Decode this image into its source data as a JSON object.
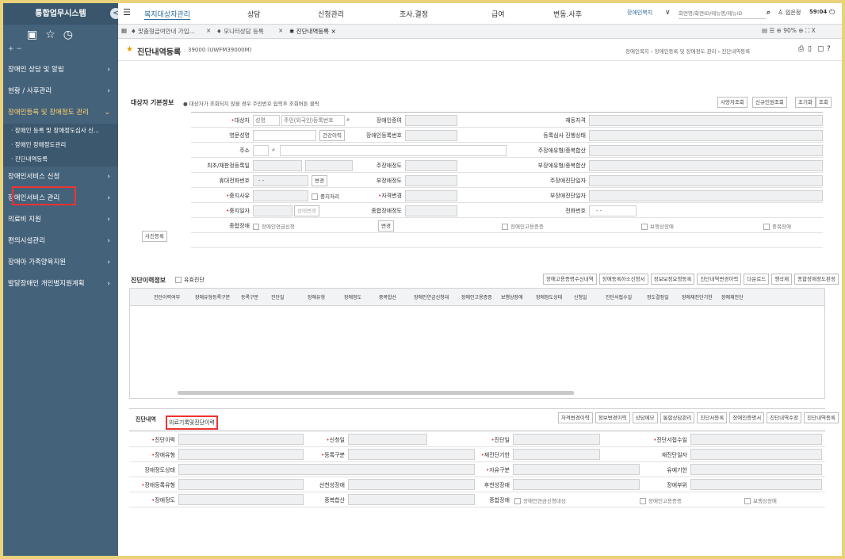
{
  "app": {
    "title": "통합업무시스템",
    "collapse": "<"
  },
  "sidebar": {
    "pm": "+ −",
    "icons": [
      "doc-icon",
      "star-icon",
      "clock-icon"
    ],
    "menu1": "장애인 상담 및 알림",
    "menu2": "현황 / 사후관리",
    "menu3": "장애인등록 및 장애정도 관리",
    "sub1": "· 장애인 등록 및 장애정도심사 신...",
    "sub2": "· 장애인 장애정도관리",
    "sub3": "· 진단내역등록",
    "menu4": "장애인서비스 신청",
    "menu5": "장애인서비스 관리",
    "menu6": "의료비 지원",
    "menu7": "편의시설관리",
    "menu8": "장애아 가족양육지원",
    "menu9": "발달장애인 개인별지원계획"
  },
  "topbar": {
    "hamburger": "☰",
    "tab1": "복지대상자관리",
    "tab2": "상담",
    "tab3": "신청관리",
    "tab4": "조사.결정",
    "tab5": "급여",
    "tab6": "변동.사후",
    "org": "장애인복지",
    "search_placeholder": "화면명/화면ID/메뉴명/메뉴ID",
    "user": "임은정",
    "timer": "59:04"
  },
  "tabs": {
    "t1": "♦ 맞춤형급여안내 가입...",
    "t2": "♦ 모니터상담 등록",
    "t3": "✱ 진단내역등록 ×",
    "right": "▤ ☰ ⊕ 90% ⊕ ⛶ X"
  },
  "page": {
    "star": "★",
    "title": "진단내역등록",
    "code": "39000 (UWFM39000M)",
    "breadcrumb": "장애인복지 › 장애인등록 및 장애정도 관리 › 진단내역등록"
  },
  "section1": {
    "title": "대상자 기본정보",
    "note": "대상자가 조회되지 않을 경우 주민번호 입력후 조회버튼 클릭",
    "btn1": "사망자조회",
    "btn2": "신규인원조회",
    "btn3": "초기화",
    "btn4": "조회"
  },
  "form": {
    "l_target": "대상자",
    "ph_name": "성명",
    "ph_rrn": "주민(외국인)등록번호",
    "l_eng": "영문성명",
    "btn_history": "건강이력",
    "l_addr": "주소",
    "l_reg_date": "최초/재판정등록일",
    "l_phone": "휴대전화번호",
    "phone_val": "-   -",
    "btn_change": "변경",
    "l_stop_reason": "중지사유",
    "stop_chk": "중지처리",
    "l_stop_date": "중지일자",
    "stop_btn": "상태변경",
    "l_type": "종합장애",
    "type_val": "장애인연금신청",
    "btn_change2": "변경",
    "l_card": "장애인증여",
    "l_cardno": "장애인등록번호",
    "l_main_deg": "주장애정도",
    "l_sub_deg": "부장애정도",
    "l_qual": "자격변경",
    "l_total": "종합장애정도",
    "l_status": "재등자격",
    "l_review": "등록심사 진행상태",
    "l_main_type": "주장애유형/중복합산",
    "l_sub_type": "부장애유형/중복합산",
    "l_main_diag": "주장애진단일자",
    "l_sub_diag": "부장애진단일자",
    "l_tel": "전화번호",
    "tel_val": "-   -",
    "chk1": "장애인고용증증",
    "chk2": "보행상장애",
    "chk3": "중복장애",
    "photo_btn": "사진등록"
  },
  "section2": {
    "title": "진단이력정보",
    "chk": "유효진단",
    "btns": [
      "장애고용증명수신내역",
      "장애등록하소신청서",
      "정보보정요청등록",
      "진단내역변경이력",
      "다운로드",
      "행삭제",
      "종합장애정도판정"
    ],
    "cols": [
      "진단이력여부",
      "장애유형등록구분",
      "등록구분",
      "진단일",
      "장애유형",
      "장애정도",
      "중복합산",
      "장애인연금신청대",
      "장애인고용증증",
      "보행상장애",
      "장애정도상태",
      "신청일",
      "진단서접수일",
      "정도결정일",
      "장애재진단기한",
      "장애재진단"
    ]
  },
  "section3": {
    "tab1": "진단내역",
    "tab2": "의료기록및진단이력",
    "btns": [
      "자격변경이력",
      "정보변경이력",
      "상담메모",
      "통합상담관리",
      "진단서등록",
      "장애인증명서",
      "진단내역수정",
      "진단내역등록"
    ],
    "l_diag_hist": "진단이력",
    "l_apply": "신청일",
    "l_diag_date": "진단일",
    "l_cert_recv": "진단서접수일",
    "l_dis_type": "장애유형",
    "l_reg_type": "등록구분",
    "l_rediag": "재진단기한",
    "l_rediag_date": "재진단일자",
    "l_dis_state": "장애정도상태",
    "l_after": "자유구분",
    "l_grace": "유예기한",
    "l_reg_kind": "장애등록유형",
    "l_select": "선천성장애",
    "l_after2": "후천성장애",
    "l_part": "장애부위",
    "l_degree": "장애정도",
    "l_dup": "중복합산",
    "l_total": "종합장애",
    "c1": "장애인연금신청대상",
    "c2": "장애인고용증증",
    "c3": "보행상장애"
  }
}
